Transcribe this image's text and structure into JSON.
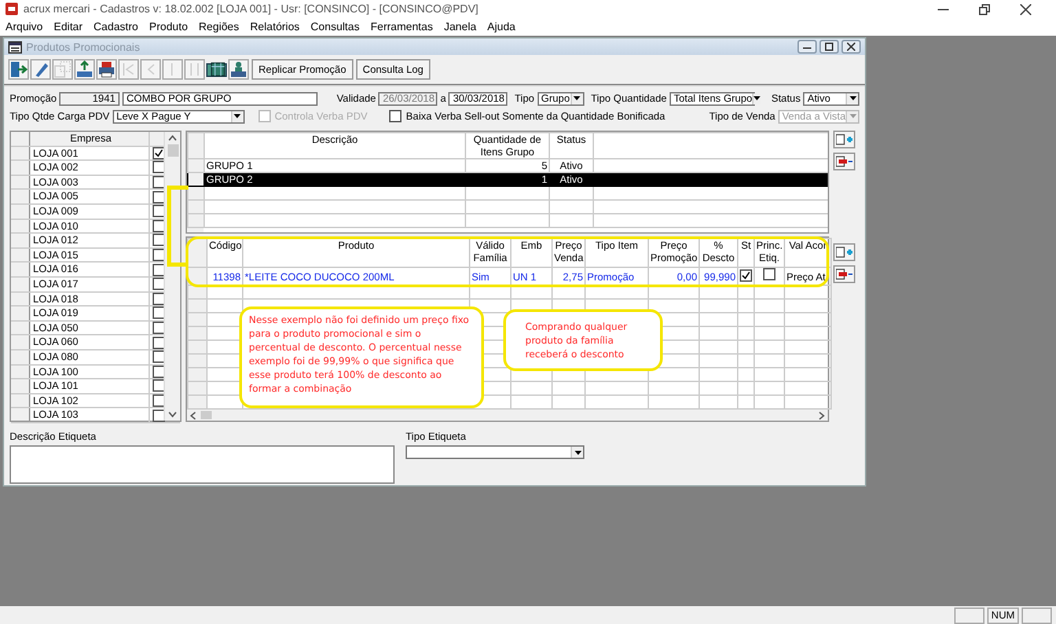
{
  "app_title": "acrux mercari - Cadastros  v: 18.02.002  [LOJA 001] - Usr: [CONSINCO] - [CONSINCO@PDV]",
  "menu": [
    "Arquivo",
    "Editar",
    "Cadastro",
    "Produto",
    "Regiões",
    "Relatórios",
    "Consultas",
    "Ferramentas",
    "Janela",
    "Ajuda"
  ],
  "window": {
    "title": "Produtos Promocionais"
  },
  "toolbar": {
    "icons": [
      {
        "kind": "exit",
        "disabled": false,
        "selected": false
      },
      {
        "kind": "eraser",
        "disabled": false,
        "selected": false
      },
      {
        "kind": "copy",
        "disabled": true,
        "selected": false
      },
      {
        "kind": "export",
        "disabled": false,
        "selected": false
      },
      {
        "kind": "print",
        "disabled": false,
        "selected": false
      },
      {
        "kind": "first",
        "disabled": true,
        "selected": false
      },
      {
        "kind": "prev",
        "disabled": true,
        "selected": false
      },
      {
        "kind": "next",
        "disabled": true,
        "selected": false
      },
      {
        "kind": "last",
        "disabled": true,
        "selected": false
      },
      {
        "kind": "grid",
        "disabled": false,
        "selected": true
      },
      {
        "kind": "stamp",
        "disabled": false,
        "selected": false
      }
    ],
    "buttons": [
      "Replicar Promoção",
      "Consulta Log"
    ]
  },
  "form": {
    "promocao_label": "Promoção",
    "promocao_code": "1941",
    "promocao_name": "COMBO POR GRUPO",
    "validade_label": "Validade",
    "validade_from": "26/03/2018",
    "validade_sep": "a",
    "validade_to": "30/03/2018",
    "tipo_label": "Tipo",
    "tipo": "Grupo",
    "tipo_quantidade_label": "Tipo Quantidade",
    "tipo_quantidade": "Total Itens Grupo",
    "status_label": "Status",
    "status": "Ativo",
    "carga_label": "Tipo Qtde Carga PDV",
    "carga": "Leve X Pague Y",
    "checkboxes": [
      {
        "label": "Controla Verba PDV",
        "checked": false,
        "disabled": true
      },
      {
        "label": "Baixa Verba Sell-out Somente da Quantidade Bonificada",
        "checked": false,
        "disabled": false
      }
    ],
    "tipo_venda_label": "Tipo de Venda",
    "tipo_venda": "Venda a Vista"
  },
  "empresas": {
    "header": "Empresa",
    "rows": [
      {
        "name": "LOJA 001",
        "checked": true
      },
      {
        "name": "LOJA 002",
        "checked": false
      },
      {
        "name": "LOJA 003",
        "checked": false
      },
      {
        "name": "LOJA 005",
        "checked": false
      },
      {
        "name": "LOJA 009",
        "checked": false
      },
      {
        "name": "LOJA 010",
        "checked": false
      },
      {
        "name": "LOJA 012",
        "checked": false
      },
      {
        "name": "LOJA 015",
        "checked": false
      },
      {
        "name": "LOJA 016",
        "checked": false
      },
      {
        "name": "LOJA 017",
        "checked": false
      },
      {
        "name": "LOJA 018",
        "checked": false
      },
      {
        "name": "LOJA 019",
        "checked": false
      },
      {
        "name": "LOJA 050",
        "checked": false
      },
      {
        "name": "LOJA 060",
        "checked": false
      },
      {
        "name": "LOJA 080",
        "checked": false
      },
      {
        "name": "LOJA 100",
        "checked": false
      },
      {
        "name": "LOJA 101",
        "checked": false
      },
      {
        "name": "LOJA 102",
        "checked": false
      },
      {
        "name": "LOJA 103",
        "checked": false
      }
    ]
  },
  "groups": {
    "columns": [
      "Descrição",
      "Quantidade de Itens Grupo",
      "Status"
    ],
    "rows": [
      {
        "descricao": "GRUPO 1",
        "quantidade": "5",
        "status": "Ativo",
        "selected": false
      },
      {
        "descricao": "GRUPO 2",
        "quantidade": "1",
        "status": "Ativo",
        "selected": true
      }
    ]
  },
  "products": {
    "columns": [
      "Código",
      "Produto",
      "Válido Família",
      "Emb",
      "Preço Venda",
      "Tipo Item",
      "Preço Promoção",
      "% Descto",
      "St",
      "Princ. Etiq.",
      "Val Acor"
    ],
    "rows": [
      {
        "codigo": "11398",
        "produto": "*LEITE COCO DUCOCO 200ML",
        "valido_familia": "Sim",
        "emb": "UN  1",
        "preco_venda": "2,75",
        "tipo_item": "Promoção",
        "preco_promocao": "0,00",
        "descto": "99,990",
        "st": true,
        "princ_etiq": false,
        "column_11": "Preço At"
      }
    ]
  },
  "notes": [
    "Nesse exemplo não foi definido um preço fixo para o produto promocional e sim o percentual de desconto. O percentual nesse exemplo foi de 99,99% o que significa que esse produto terá 100% de desconto ao formar a combinação",
    "Comprando qualquer produto da família receberá o desconto"
  ],
  "descricao_etiqueta_label": "Descrição Etiqueta",
  "tipo_etiqueta_label": "Tipo Etiqueta",
  "status_bar": {
    "panels": [
      "NUM"
    ]
  }
}
